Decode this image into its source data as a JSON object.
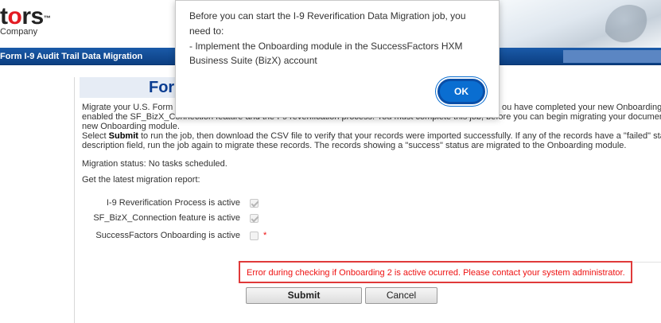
{
  "header": {
    "logo_prefix": "t",
    "logo_accent": "o",
    "logo_suffix": "rs",
    "logo_tm": "™",
    "logo_sub": "Company"
  },
  "titlebar": {
    "title": "Form I-9 Audit Trail Data Migration"
  },
  "page_title": "For",
  "body": {
    "line1": "Migrate your U.S. Form",
    "line2": "enabled the SF_BizX_Connection feature and the I-9 reverification process. You must complete this job, before you can begin migrating your document",
    "line2_right": "ou have completed your new Onboarding",
    "line3": "new Onboarding module.",
    "line4_prefix": "Select",
    "line4_bold": "Submit",
    "line4_suffix": "to run the job, then download the CSV file to verify that your records were imported successfully. If any of the records have a \"failed\" sta",
    "line5": "description field, run the job again to migrate these records. The records showing a \"success\" status are migrated to the Onboarding module.",
    "migration_status": "Migration status: No tasks scheduled.",
    "report_label": "Get the latest migration report:"
  },
  "checks": [
    {
      "label": "I-9 Reverification Process is active",
      "checked": true
    },
    {
      "label": "SF_BizX_Connection feature is active",
      "checked": true
    },
    {
      "label": "SuccessFactors Onboarding is active",
      "checked": false,
      "required": "*"
    }
  ],
  "error": {
    "message": "Error during checking if Onboarding 2 is active ocurred. Please contact your system administrator."
  },
  "buttons": {
    "submit": "Submit",
    "cancel": "Cancel"
  },
  "modal": {
    "line1": "Before you can start the I-9 Reverification Data Migration job, you",
    "line2": "need to:",
    "line3": "- Implement the Onboarding module in the SuccessFactors HXM",
    "line4": "Business Suite (BizX) account",
    "ok": "OK"
  },
  "colors": {
    "titlebar": "#0c3f82",
    "ok_button": "#0a6ed1",
    "error": "#e03a3a",
    "page_title": "#0b3d91"
  }
}
